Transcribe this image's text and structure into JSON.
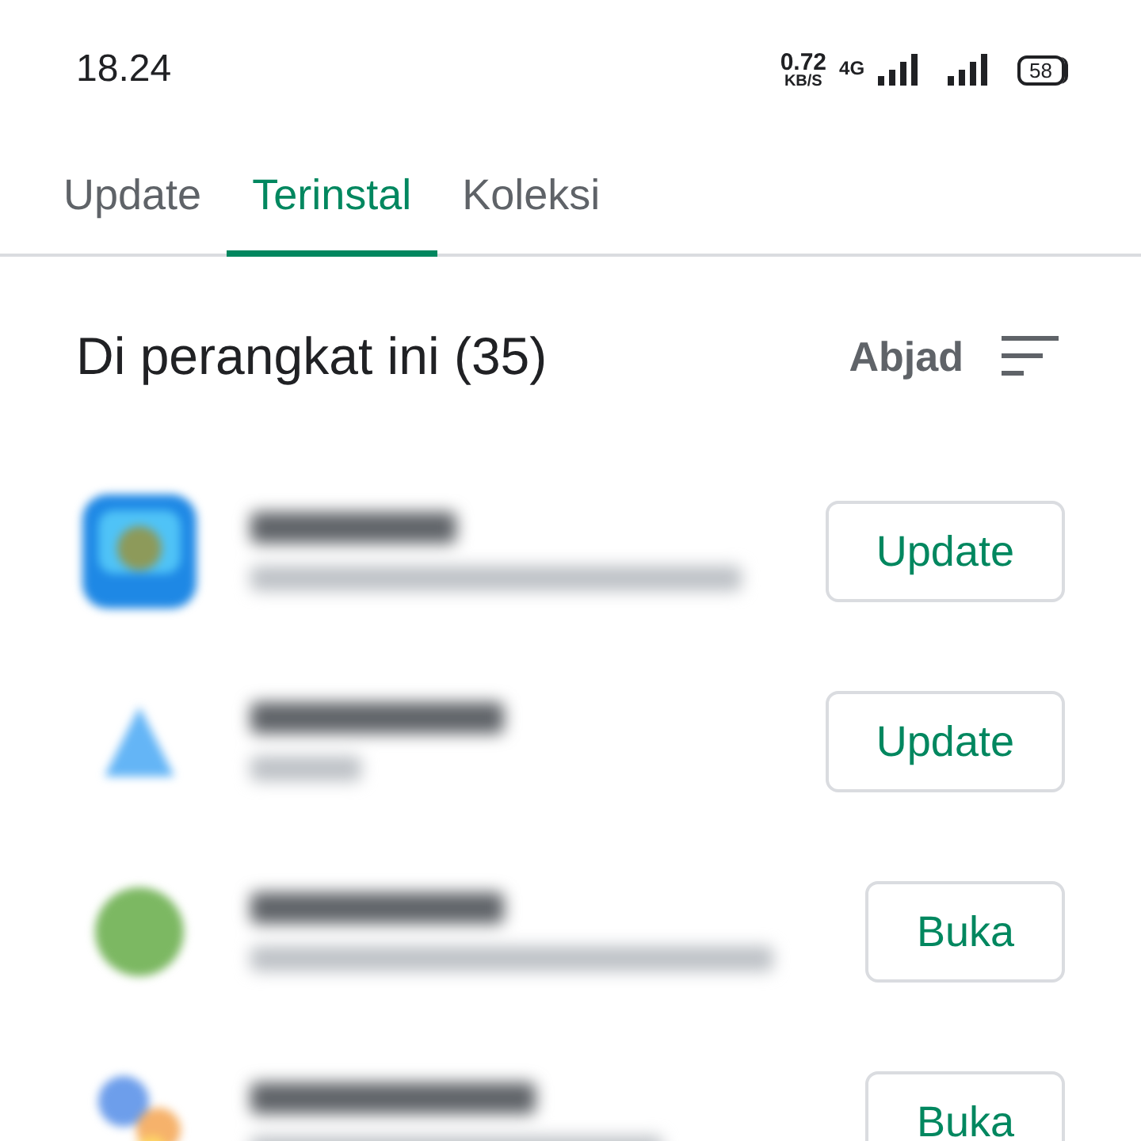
{
  "status_bar": {
    "time": "18.24",
    "speed": "0.72",
    "speed_unit": "KB/S",
    "network": "4G",
    "battery": "58"
  },
  "tabs": [
    {
      "label": "Update",
      "selected": false
    },
    {
      "label": "Terinstal",
      "selected": true
    },
    {
      "label": "Koleksi",
      "selected": false
    }
  ],
  "section": {
    "title": "Di perangkat ini (35)",
    "sort": "Abjad"
  },
  "apps": [
    {
      "kind": "game",
      "button": "Update"
    },
    {
      "kind": "triangle",
      "button": "Update"
    },
    {
      "kind": "circle",
      "button": "Buka"
    },
    {
      "kind": "dots",
      "button": "Buka"
    }
  ]
}
